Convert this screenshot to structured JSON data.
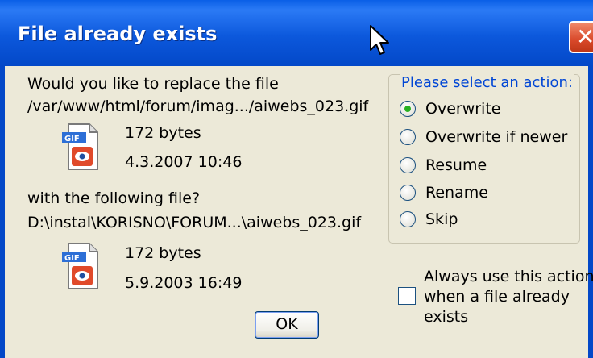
{
  "window": {
    "title": "File already exists"
  },
  "dialog": {
    "question": "Would you like to replace the file",
    "existing_file": {
      "path": "/var/www/html/forum/imag.../aiwebs_023.gif",
      "size": "172 bytes",
      "date": "4.3.2007 10:46",
      "icon": "gif-file-icon"
    },
    "with_text": "with the following file?",
    "new_file": {
      "path": "D:\\instal\\KORISNO\\FORUM...\\aiwebs_023.gif",
      "size": "172 bytes",
      "date": "5.9.2003 16:49",
      "icon": "gif-file-icon"
    },
    "action_group": {
      "label": "Please select an action:",
      "options": [
        "Overwrite",
        "Overwrite if newer",
        "Resume",
        "Rename",
        "Skip"
      ],
      "selected": "Overwrite"
    },
    "always_use": {
      "line1": "Always use this action",
      "line2": "when a file already",
      "line3": "exists",
      "checked": false
    },
    "ok_label": "OK"
  },
  "colors": {
    "title_bar": "#0348c8",
    "legend_text": "#0046d5",
    "radio_selected": "#27b020",
    "close_button": "#d9492a"
  }
}
